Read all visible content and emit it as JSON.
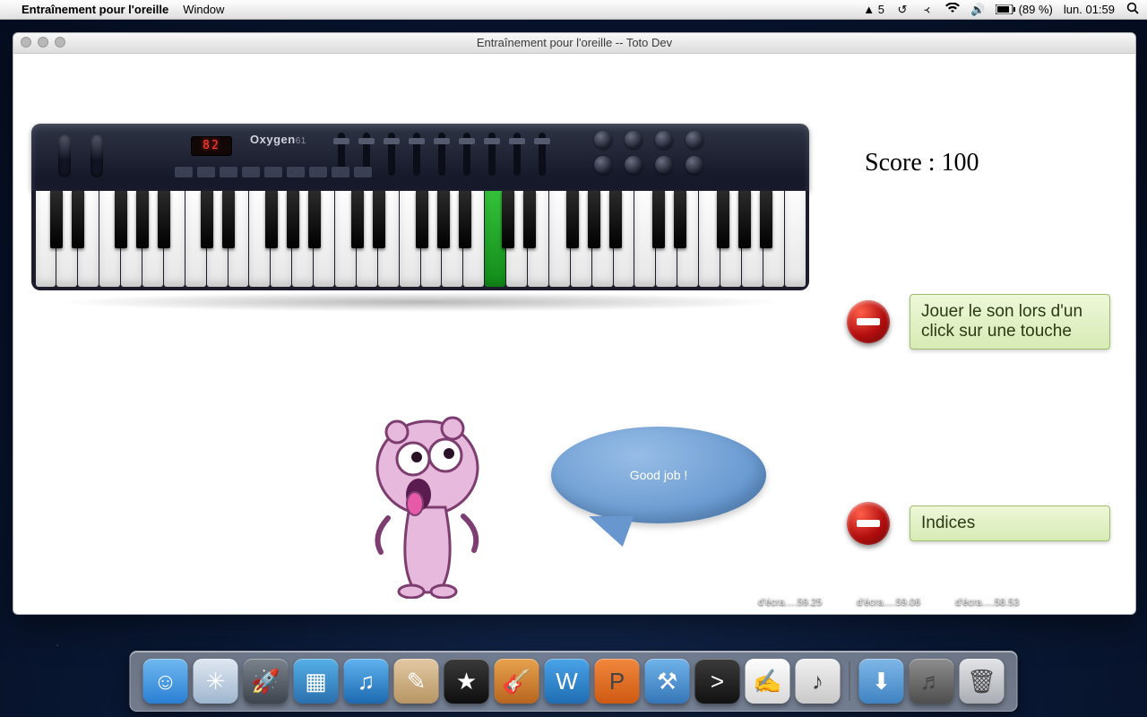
{
  "menubar": {
    "app_name": "Entraînement pour l'oreille",
    "menu_window": "Window",
    "adobe_label": "5",
    "battery": "(89 %)",
    "clock": "lun. 01:59"
  },
  "window": {
    "title": "Entraînement pour l'oreille -- Toto Dev"
  },
  "keyboard": {
    "brand": "Oxygen",
    "brand_suffix": "61",
    "lcd": "82"
  },
  "score": {
    "label": "Score :",
    "value": "100"
  },
  "options": {
    "play_on_click": "Jouer le son lors d'un click sur une touche",
    "hints": "Indices"
  },
  "bubble": {
    "text": "Good job !"
  },
  "desk_files": {
    "f1": "d'écra….59.25",
    "f2": "d'écra….59.06",
    "f3": "d'écra….58.53"
  },
  "dock": {
    "items": [
      {
        "name": "finder",
        "bg": "linear-gradient(#6fb9f0,#2a7fd4)",
        "glyph": "☺"
      },
      {
        "name": "safari",
        "bg": "linear-gradient(#dfe8f1,#9fb6cf)",
        "glyph": "✳"
      },
      {
        "name": "launchpad",
        "bg": "linear-gradient(#7a828c,#3d444e)",
        "glyph": "🚀"
      },
      {
        "name": "mission-control",
        "bg": "linear-gradient(#55b0e6,#2a6fae)",
        "glyph": "▦"
      },
      {
        "name": "itunes",
        "bg": "linear-gradient(#5fb3ef,#1c69b0)",
        "glyph": "♫"
      },
      {
        "name": "gimp",
        "bg": "linear-gradient(#e2c9a4,#b89563)",
        "glyph": "✎"
      },
      {
        "name": "imovie",
        "bg": "linear-gradient(#3a3a3a,#0e0e0e)",
        "glyph": "★"
      },
      {
        "name": "garageband",
        "bg": "linear-gradient(#e7a24d,#b8651f)",
        "glyph": "🎸"
      },
      {
        "name": "word",
        "bg": "linear-gradient(#4aa3e8,#1f6db3)",
        "glyph": "W"
      },
      {
        "name": "powerpoint",
        "bg": "linear-gradient(#f0873d,#cf5a12)",
        "glyph": "P"
      },
      {
        "name": "xcode",
        "bg": "linear-gradient(#6fb3ea,#3676b8)",
        "glyph": "⚒"
      },
      {
        "name": "terminal",
        "bg": "linear-gradient(#3b3b3b,#111)",
        "glyph": ">"
      },
      {
        "name": "textedit",
        "bg": "linear-gradient(#fefefe,#d8d8d8)",
        "glyph": "✍"
      },
      {
        "name": "app",
        "bg": "linear-gradient(#f0f0f0,#c9c9c9)",
        "glyph": "♪"
      }
    ],
    "right": [
      {
        "name": "downloads",
        "bg": "linear-gradient(#7fb7e8,#3f83c2)",
        "glyph": "⬇"
      },
      {
        "name": "music-stack",
        "bg": "linear-gradient(#8d8d8d,#4e4e4e)",
        "glyph": "♬"
      },
      {
        "name": "trash",
        "bg": "linear-gradient(#e2e4e7,#a9adb3)",
        "glyph": "🗑"
      }
    ]
  }
}
